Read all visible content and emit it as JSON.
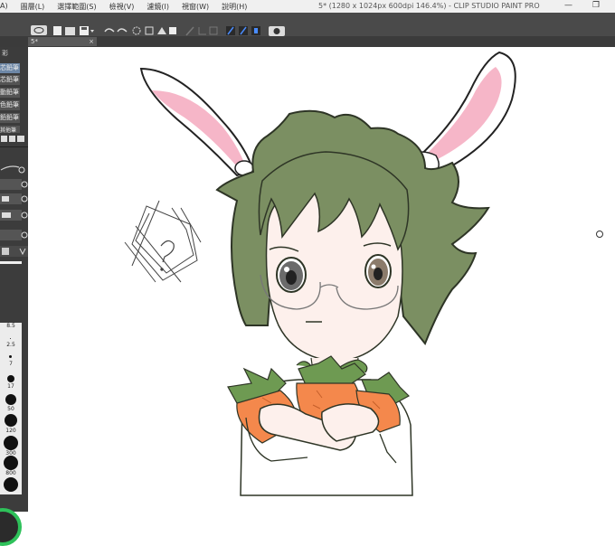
{
  "menu": [
    "A)",
    "圖層(L)",
    "選擇範圍(S)",
    "檢視(V)",
    "濾鏡(I)",
    "視窗(W)",
    "說明(H)"
  ],
  "window_title": "5* (1280 x 1024px 600dpi 146.4%) - CLIP STUDIO PAINT PRO",
  "window_controls": {
    "minimize": "—",
    "restore": "❐"
  },
  "doc_tab": {
    "label": "5*",
    "close": "×"
  },
  "panel_header": "彩",
  "sub_tools": [
    "芯鉛筆",
    "芯鉛筆",
    "動鉛筆",
    "色鉛筆",
    "鉛鉛筆",
    "其他筆"
  ],
  "active_sub_tool_index": 0,
  "brush_sizes": [
    "8.5",
    "2.5",
    "7",
    "17",
    "50",
    "120",
    "300",
    "800"
  ],
  "colors": {
    "toolbar": "#4a4a4a",
    "panel": "#3c3c3c",
    "hair": "#7b8f62",
    "carrot": "#f4884c",
    "leaf": "#6e9a52",
    "ear_inner": "#f6b6c8",
    "wheel": "#2ec15a"
  }
}
